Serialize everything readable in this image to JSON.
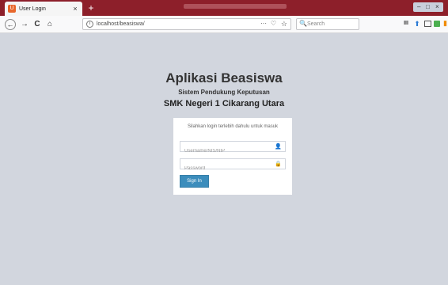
{
  "browser": {
    "tab_title": "User Login",
    "tab_favicon": "U",
    "tab_close": "×",
    "new_tab": "+",
    "url": "localhost/beasiswa/",
    "search_placeholder": "Search",
    "icons": {
      "back": "←",
      "forward": "→",
      "reload": "C",
      "home": "⌂",
      "info": "i",
      "more": "···",
      "pocket": "♡",
      "bookmark": "☆",
      "search": "🔍",
      "library": "III"
    }
  },
  "app": {
    "title": "Aplikasi Beasiswa",
    "subtitle": "Sistem Pendukung Keputusan",
    "school": "SMK Negeri 1 Cikarang Utara"
  },
  "login": {
    "message": "Silahkan login terlebih dahulu untuk masuk",
    "username_placeholder": "Username/NIS/NIP",
    "password_placeholder": "Password",
    "username_icon": "👤",
    "password_icon": "🔒",
    "signin_label": "Sign In"
  },
  "colors": {
    "titlebar": "#8d1f2a",
    "page_background": "#d2d6de",
    "button": "#3c8dbc",
    "favicon": "#e8672c"
  }
}
